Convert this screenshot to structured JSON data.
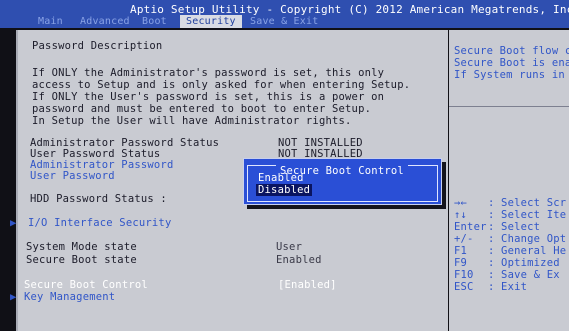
{
  "header": {
    "title": "Aptio Setup Utility - Copyright (C) 2012 American Megatrends, Inc.",
    "tabs": [
      "Main",
      "Advanced",
      "Boot",
      "Security",
      "Save & Exit"
    ],
    "active_tab": "Security"
  },
  "main": {
    "section_title": "Password Description",
    "description": [
      "If ONLY the Administrator's password is set, this only",
      "access to Setup and is only asked for when entering Setup.",
      "If ONLY the User's password is set, this is a power on",
      "password and must be entered to boot to enter Setup.",
      "In Setup the User will have Administrator rights."
    ],
    "admin_status_label": "Administrator Password Status",
    "admin_status_value": "NOT INSTALLED",
    "user_status_label": "User Password Status",
    "user_status_value": "NOT INSTALLED",
    "admin_password_label": "Administrator Password",
    "user_password_label": "User Password",
    "hdd_status_label": "HDD Password Status  :",
    "io_interface_label": "I/O Interface Security",
    "system_mode_label": "System Mode state",
    "system_mode_value": "User",
    "secure_boot_state_label": "Secure Boot state",
    "secure_boot_state_value": "Enabled",
    "secure_boot_control_label": "Secure Boot Control",
    "secure_boot_control_value": "[Enabled]",
    "key_management_label": "Key Management",
    "submenu_arrow": "▶"
  },
  "popup": {
    "title": "Secure Boot Control",
    "options": [
      "Enabled",
      "Disabled"
    ],
    "selected": "Disabled"
  },
  "help": {
    "lines": [
      "Secure Boot flow c",
      "Secure Boot is ena",
      "If System runs in"
    ]
  },
  "keys": [
    {
      "key": "→←",
      "desc": ": Select Scr"
    },
    {
      "key": "↑↓",
      "desc": ": Select Ite"
    },
    {
      "key": "Enter",
      "desc": ": Select"
    },
    {
      "key": "+/-",
      "desc": ": Change Opt"
    },
    {
      "key": "F1",
      "desc": ": General He"
    },
    {
      "key": "F9",
      "desc": ": Optimized"
    },
    {
      "key": "F10",
      "desc": ": Save & Ex"
    },
    {
      "key": "ESC",
      "desc": ": Exit"
    }
  ],
  "colors": {
    "header_bg": "#2f4fb0",
    "panel_bg": "#c9cbd2",
    "link_blue": "#3156c8",
    "popup_bg": "#2a4fd6"
  }
}
